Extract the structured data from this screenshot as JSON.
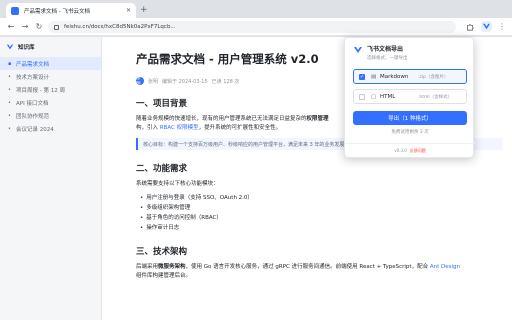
{
  "browser": {
    "tab_title": "产品需求文档 - 飞书云文档",
    "new_tab": "+",
    "url": "feishu.cn/docs/hxC8d5Nk0a2PxF7Lqcb...",
    "menu": "⋮"
  },
  "sidebar": {
    "title": "知识库",
    "items": [
      {
        "label": "产品需求文档"
      },
      {
        "label": "技术方案设计"
      },
      {
        "label": "项目周报 - 第 12 周"
      },
      {
        "label": "API 接口文档"
      },
      {
        "label": "团队协作规范"
      },
      {
        "label": "会议记录 2024"
      }
    ]
  },
  "doc": {
    "title": "产品需求文档 - 用户管理系统 v2.0",
    "avatar_text": "张明",
    "author": "张明",
    "edited": "编辑于 2024-03-15",
    "views": "已读 128 次",
    "s1_heading": "一、项目背景",
    "s1_p_a": "随着业务规模的快速增长，现有的用户管理系统已无法满足日益复杂的",
    "s1_p_b": "权限管理",
    "s1_p_c": "构，引入 ",
    "s1_p_link": "RBAC 权限模型",
    "s1_p_d": "，提升系统的可扩展性和安全性。",
    "callout": "核心目标：构建一个支持百万级用户、秒级响应的用户管理平台，满足未来 3 年的业务发展需求。",
    "s2_heading": "二、功能需求",
    "s2_intro": "系统需要支持以下核心功能模块：",
    "s2_list": [
      "用户注册与登录（支持 SSO、OAuth 2.0）",
      "多级组织架构管理",
      "基于角色的访问控制（RBAC）",
      "操作审计日志"
    ],
    "s3_heading": "三、技术架构",
    "s3_p_a": "后端采用",
    "s3_p_b": "微服务架构",
    "s3_p_c": "，使用 Go 语言开发核心服务，通过 gRPC 进行服务间通信。前端使用 React + TypeScript，配合 ",
    "s3_p_link": "Ant Design",
    "s3_p_d": "组件库构建管理后台。"
  },
  "popup": {
    "title": "飞书文档导出",
    "subtitle": "选择格式，一键导出",
    "options": [
      {
        "label": "Markdown",
        "ext": ".zip（含图片）",
        "checked": true,
        "icon": "markdown-icon"
      },
      {
        "label": "HTML",
        "ext": ".html（含样式）",
        "checked": false,
        "icon": "html-icon"
      }
    ],
    "export_label": "导出（1 种格式）",
    "quota": "免费试用剩余 3 次",
    "version": "v0.3.0",
    "feedback": "反馈问题"
  },
  "colors": {
    "accent": "#3370ff",
    "feedback": "#f54a45"
  }
}
